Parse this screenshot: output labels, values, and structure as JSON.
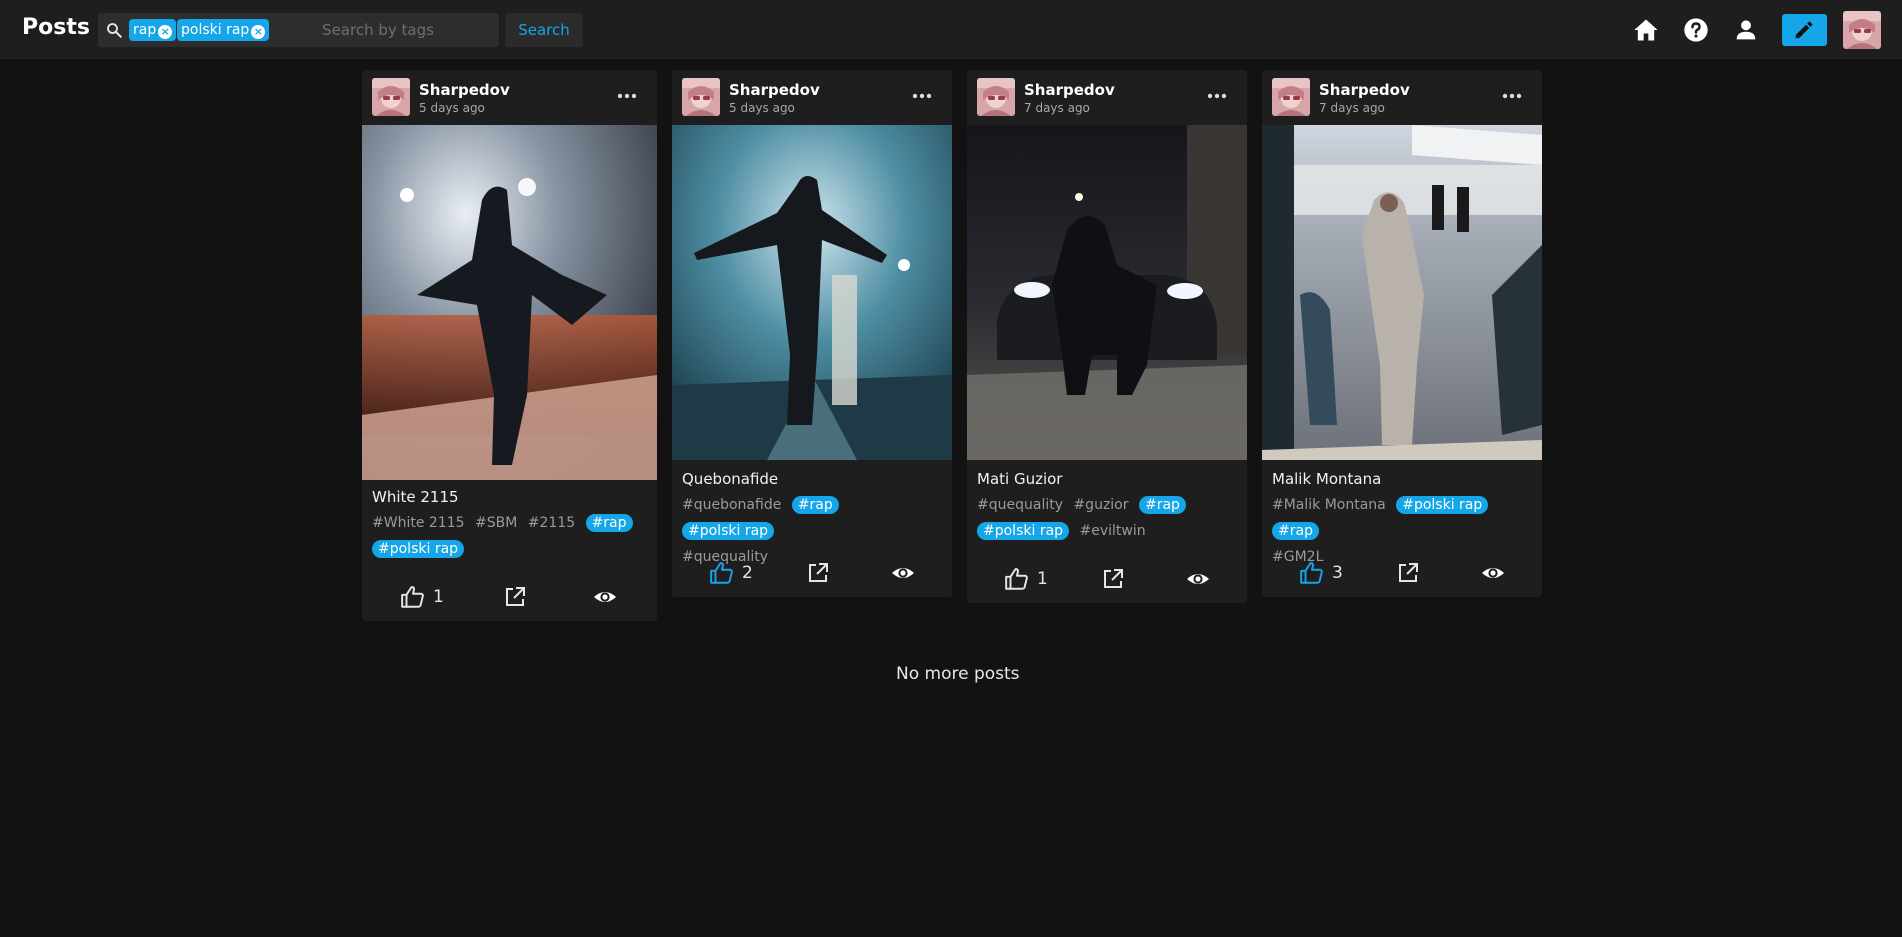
{
  "header": {
    "title": "Posts",
    "search_placeholder": "Search by tags",
    "active_tags": [
      "rap",
      "polski rap"
    ],
    "search_label": "Search",
    "nav_icons": [
      "home-icon",
      "help-icon",
      "account-icon"
    ],
    "edit_icon": "pencil-icon"
  },
  "colors": {
    "accent": "#14a6e8",
    "background": "#121212",
    "surface": "#1e1e1e"
  },
  "posts": [
    {
      "author": "Sharpedov",
      "time": "5 days ago",
      "title": "White 2115",
      "tags": [
        "#White 2115",
        "#SBM",
        "#2115",
        "#rap",
        "#polski rap"
      ],
      "likes": "1",
      "liked": false
    },
    {
      "author": "Sharpedov",
      "time": "5 days ago",
      "title": "Quebonafide",
      "tags": [
        "#quebonafide",
        "#rap",
        "#polski rap",
        "#quequality"
      ],
      "likes": "2",
      "liked": true
    },
    {
      "author": "Sharpedov",
      "time": "7 days ago",
      "title": "Mati Guzior",
      "tags": [
        "#quequality",
        "#guzior",
        "#rap",
        "#polski rap",
        "#eviltwin"
      ],
      "likes": "1",
      "liked": false
    },
    {
      "author": "Sharpedov",
      "time": "7 days ago",
      "title": "Malik Montana",
      "tags": [
        "#Malik Montana",
        "#polski rap",
        "#rap",
        "#GM2L"
      ],
      "likes": "3",
      "liked": true
    }
  ],
  "footer": {
    "no_more": "No more posts"
  }
}
